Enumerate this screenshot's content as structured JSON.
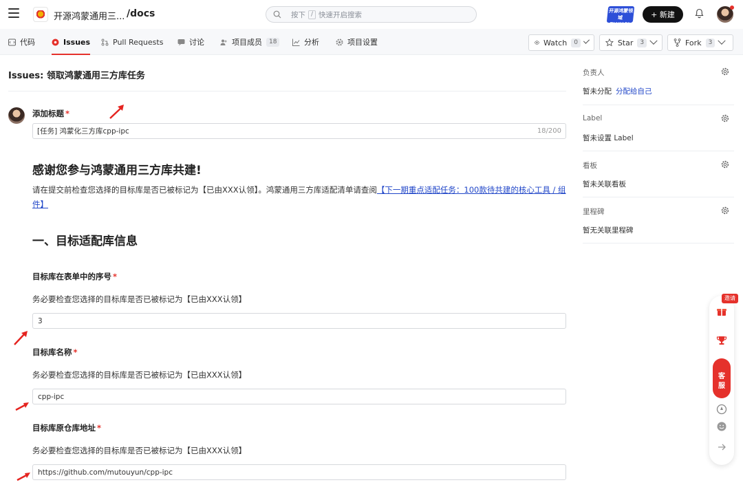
{
  "header": {
    "repo_name": "开源鸿蒙通用三...",
    "repo_path": "/docs",
    "search_prefix": "按下",
    "search_key": "/",
    "search_placeholder": "快速开启搜索",
    "promo_text": "开源鸿蒙领域\n联创计划",
    "new_button": "+ 新建"
  },
  "tabs": [
    {
      "label": "代码",
      "icon": "code-icon"
    },
    {
      "label": "Issues",
      "icon": "issues-icon",
      "active": true
    },
    {
      "label": "Pull Requests",
      "icon": "pull-request-icon"
    },
    {
      "label": "讨论",
      "icon": "discussion-icon"
    },
    {
      "label": "项目成员",
      "icon": "members-icon",
      "count": "18"
    },
    {
      "label": "分析",
      "icon": "analytics-icon"
    },
    {
      "label": "项目设置",
      "icon": "settings-icon"
    }
  ],
  "repo_actions": {
    "watch": {
      "label": "Watch",
      "count": "0"
    },
    "star": {
      "label": "Star",
      "count": "3"
    },
    "fork": {
      "label": "Fork",
      "count": "3"
    }
  },
  "page": {
    "title": "Issues: 领取鸿蒙通用三方库任务"
  },
  "form": {
    "title_label": "添加标题",
    "title_value": "[任务] 鸿蒙化三方库cpp-ipc",
    "title_counter": "18/200",
    "heading_thanks": "感谢您参与鸿蒙通用三方库共建!",
    "intro_text": "请在提交前检查您选择的目标库是否已被标记为【已由XXX认领】。鸿蒙通用三方库适配清单请查阅",
    "intro_link": "【下一期重点适配任务：100款待共建的核心工具 / 组件】",
    "section_heading": "一、目标适配库信息",
    "fields": [
      {
        "label": "目标库在表单中的序号",
        "help": "务必要检查您选择的目标库是否已被标记为【已由XXX认领】",
        "value": "3"
      },
      {
        "label": "目标库名称",
        "help": "务必要检查您选择的目标库是否已被标记为【已由XXX认领】",
        "value": "cpp-ipc"
      },
      {
        "label": "目标库原仓库地址",
        "help": "务必要检查您选择的目标库是否已被标记为【已由XXX认领】",
        "value": "https://github.com/mutouyun/cpp-ipc"
      }
    ]
  },
  "sidebar": {
    "assignee": {
      "label": "负责人",
      "value": "暂未分配",
      "link": "分配给自己"
    },
    "label": {
      "label": "Label",
      "value": "暂未设置 Label"
    },
    "board": {
      "label": "看板",
      "value": "暂未关联看板"
    },
    "milestone": {
      "label": "里程碑",
      "value": "暂无关联里程碑"
    }
  },
  "floating": {
    "invite": "邀请",
    "service": "客\n服"
  },
  "colors": {
    "accent_red": "#e5312b",
    "link_blue": "#2046c8"
  }
}
